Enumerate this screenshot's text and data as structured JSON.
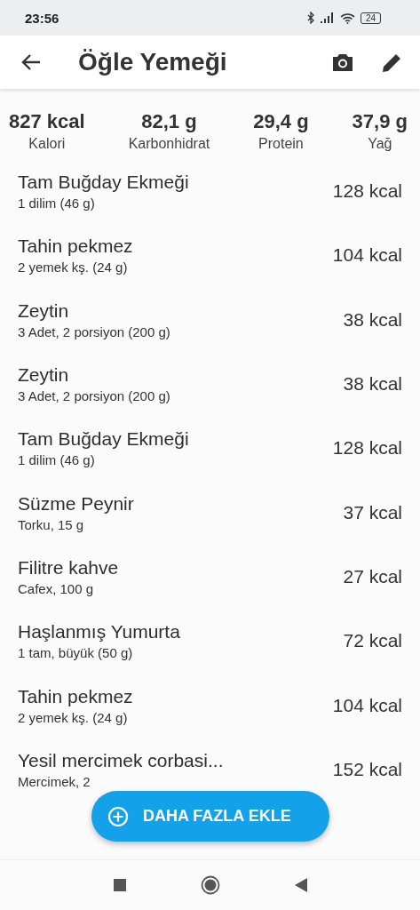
{
  "status_bar": {
    "time": "23:56",
    "battery": "24"
  },
  "header": {
    "title": "Öğle Yemeği"
  },
  "summary": [
    {
      "value": "827 kcal",
      "label": "Kalori"
    },
    {
      "value": "82,1 g",
      "label": "Karbonhidrat"
    },
    {
      "value": "29,4 g",
      "label": "Protein"
    },
    {
      "value": "37,9 g",
      "label": "Yağ"
    }
  ],
  "foods": [
    {
      "name": "Tam Buğday Ekmeği",
      "portion": "1 dilim (46 g)",
      "kcal": "128 kcal"
    },
    {
      "name": "Tahin pekmez",
      "portion": "2 yemek kş. (24 g)",
      "kcal": "104 kcal"
    },
    {
      "name": "Zeytin",
      "portion": "3 Adet, 2 porsiyon (200 g)",
      "kcal": "38 kcal"
    },
    {
      "name": "Zeytin",
      "portion": "3 Adet, 2 porsiyon (200 g)",
      "kcal": "38 kcal"
    },
    {
      "name": "Tam Buğday Ekmeği",
      "portion": "1 dilim (46 g)",
      "kcal": "128 kcal"
    },
    {
      "name": "Süzme Peynir",
      "portion": "Torku, 15 g",
      "kcal": "37 kcal"
    },
    {
      "name": "Filitre kahve",
      "portion": "Cafex, 100 g",
      "kcal": "27 kcal"
    },
    {
      "name": "Haşlanmış Yumurta",
      "portion": "1 tam, büyük (50 g)",
      "kcal": "72 kcal"
    },
    {
      "name": "Tahin pekmez",
      "portion": "2 yemek kş. (24 g)",
      "kcal": "104 kcal"
    },
    {
      "name": "Yesil mercimek corbasi...",
      "portion": "Mercimek, 2",
      "kcal": "152 kcal"
    }
  ],
  "add_button": "DAHA FAZLA EKLE"
}
